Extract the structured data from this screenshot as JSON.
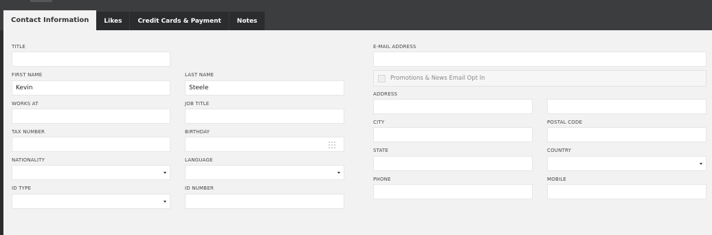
{
  "tabs": [
    {
      "label": "Contact Information",
      "active": true
    },
    {
      "label": "Likes",
      "active": false
    },
    {
      "label": "Credit Cards & Payment",
      "active": false
    },
    {
      "label": "Notes",
      "active": false
    }
  ],
  "form": {
    "title": {
      "label": "TITLE",
      "value": ""
    },
    "first_name": {
      "label": "FIRST NAME",
      "value": "Kevin"
    },
    "last_name": {
      "label": "LAST NAME",
      "value": "Steele"
    },
    "works_at": {
      "label": "WORKS AT",
      "value": ""
    },
    "job_title": {
      "label": "JOB TITLE",
      "value": ""
    },
    "tax_number": {
      "label": "TAX NUMBER",
      "value": ""
    },
    "birthday": {
      "label": "BIRTHDAY",
      "value": "",
      "icon": "calendar-grid-icon"
    },
    "nationality": {
      "label": "NATIONALITY",
      "value": ""
    },
    "language": {
      "label": "LANGUAGE",
      "value": ""
    },
    "id_type": {
      "label": "ID TYPE",
      "value": ""
    },
    "id_number": {
      "label": "ID NUMBER",
      "value": ""
    },
    "email": {
      "label": "E-MAIL ADDRESS",
      "value": ""
    },
    "optin": {
      "label": "Promotions & News Email Opt In",
      "checked": false
    },
    "address": {
      "label": "ADDRESS",
      "line1": "",
      "line2": ""
    },
    "city": {
      "label": "CITY",
      "value": ""
    },
    "postal_code": {
      "label": "POSTAL CODE",
      "value": ""
    },
    "state": {
      "label": "STATE",
      "value": ""
    },
    "country": {
      "label": "COUNTRY",
      "value": ""
    },
    "phone": {
      "label": "PHONE",
      "value": ""
    },
    "mobile": {
      "label": "MOBILE",
      "value": ""
    }
  },
  "colors": {
    "background": "#3c3d3f",
    "tab_bar": "#2b2c2e",
    "panel": "#f2f2f2",
    "input": "#ffffff"
  }
}
